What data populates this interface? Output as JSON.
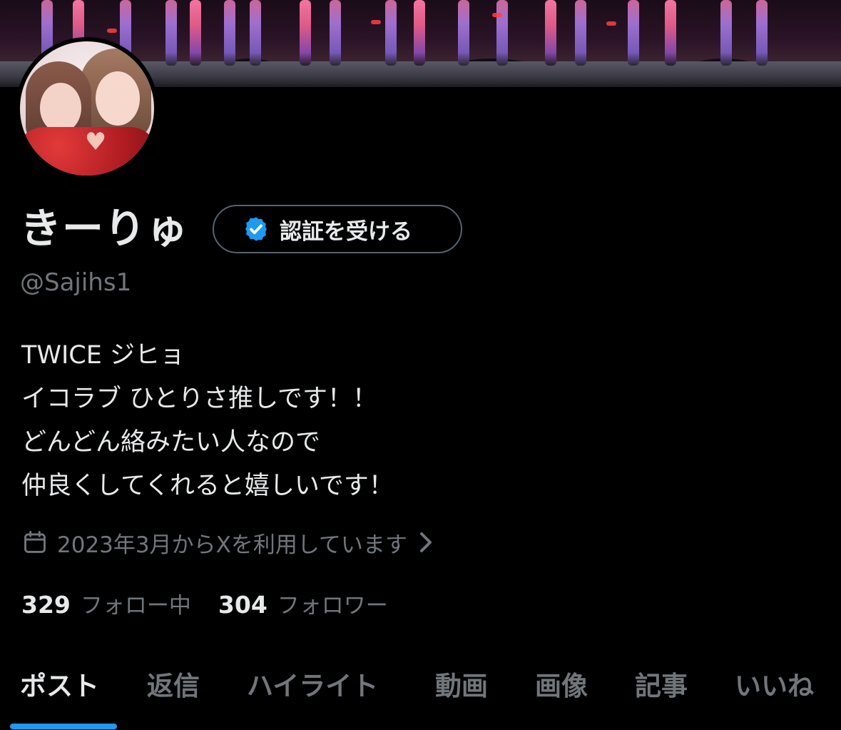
{
  "profile": {
    "display_name": "きーりゅ",
    "verify_button_label": "認証を受ける",
    "handle": "@Sajihs1",
    "bio_lines": [
      "TWICE ジヒョ",
      "イコラブ ひとりさ推しです！！",
      "どんどん絡みたい人なので",
      "仲良くしてくれると嬉しいです！"
    ],
    "joined_text": "2023年3月からXを利用しています",
    "following_count": "329",
    "following_label": "フォロー中",
    "followers_count": "304",
    "followers_label": "フォロワー"
  },
  "tabs": [
    {
      "label": "ポスト",
      "active": true
    },
    {
      "label": "返信"
    },
    {
      "label": "ハイライト"
    },
    {
      "label": "動画"
    },
    {
      "label": "画像"
    },
    {
      "label": "記事"
    },
    {
      "label": "いいね"
    }
  ],
  "colors": {
    "background": "#000000",
    "text_primary": "#e7e9ea",
    "text_secondary": "#71767b",
    "accent": "#1d9bf0",
    "border": "#536471"
  },
  "icons": {
    "verified": "verified-badge-icon",
    "calendar": "calendar-icon",
    "chevron": "chevron-right-icon"
  }
}
